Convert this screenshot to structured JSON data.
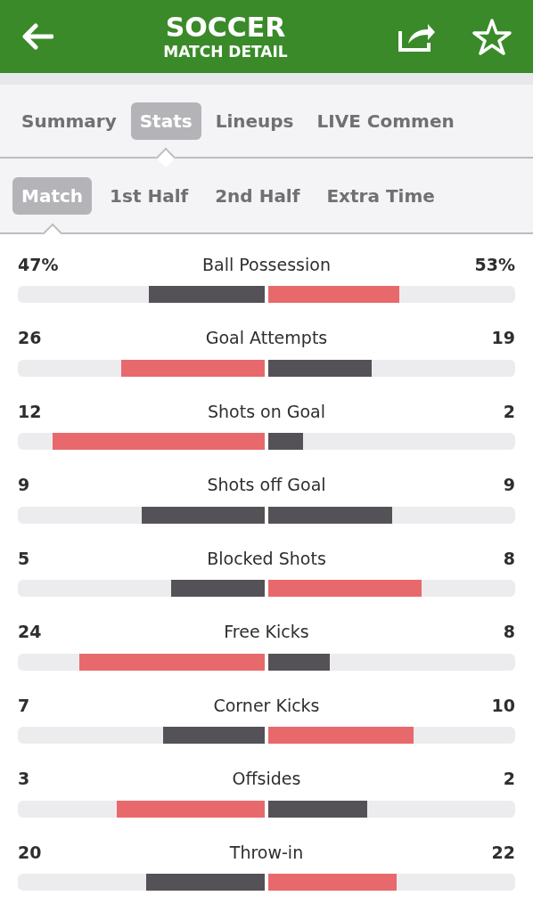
{
  "header": {
    "title": "SOCCER",
    "subtitle": "MATCH DETAIL"
  },
  "tabs": [
    {
      "label": "Summary",
      "selected": false
    },
    {
      "label": "Stats",
      "selected": true
    },
    {
      "label": "Lineups",
      "selected": false
    },
    {
      "label": "LIVE Commen",
      "selected": false
    }
  ],
  "periods": [
    {
      "label": "Match",
      "selected": true
    },
    {
      "label": "1st Half",
      "selected": false
    },
    {
      "label": "2nd Half",
      "selected": false
    },
    {
      "label": "Extra Time",
      "selected": false
    }
  ],
  "stats": [
    {
      "name": "Ball Possession",
      "home": {
        "value": "47%",
        "level": 0.47,
        "color": "#555257"
      },
      "away": {
        "value": "53%",
        "level": 0.53,
        "color": "#e8696c"
      }
    },
    {
      "name": "Goal Attempts",
      "home": {
        "value": "26",
        "level": 0.58,
        "color": "#e8696c"
      },
      "away": {
        "value": "19",
        "level": 0.42,
        "color": "#555257"
      }
    },
    {
      "name": "Shots on Goal",
      "home": {
        "value": "12",
        "level": 0.86,
        "color": "#e8696c"
      },
      "away": {
        "value": "2",
        "level": 0.14,
        "color": "#555257"
      }
    },
    {
      "name": "Shots off Goal",
      "home": {
        "value": "9",
        "level": 0.5,
        "color": "#555257"
      },
      "away": {
        "value": "9",
        "level": 0.5,
        "color": "#555257"
      }
    },
    {
      "name": "Blocked Shots",
      "home": {
        "value": "5",
        "level": 0.38,
        "color": "#555257"
      },
      "away": {
        "value": "8",
        "level": 0.62,
        "color": "#e8696c"
      }
    },
    {
      "name": "Free Kicks",
      "home": {
        "value": "24",
        "level": 0.75,
        "color": "#e8696c"
      },
      "away": {
        "value": "8",
        "level": 0.25,
        "color": "#555257"
      }
    },
    {
      "name": "Corner Kicks",
      "home": {
        "value": "7",
        "level": 0.41,
        "color": "#555257"
      },
      "away": {
        "value": "10",
        "level": 0.59,
        "color": "#e8696c"
      }
    },
    {
      "name": "Offsides",
      "home": {
        "value": "3",
        "level": 0.6,
        "color": "#e8696c"
      },
      "away": {
        "value": "2",
        "level": 0.4,
        "color": "#555257"
      }
    },
    {
      "name": "Throw-in",
      "home": {
        "value": "20",
        "level": 0.48,
        "color": "#555257"
      },
      "away": {
        "value": "22",
        "level": 0.52,
        "color": "#e8696c"
      }
    }
  ]
}
